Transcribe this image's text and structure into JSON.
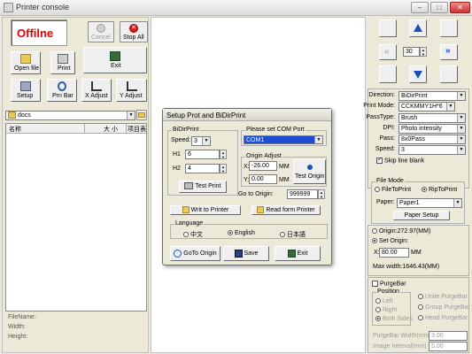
{
  "window": {
    "title": "Printer console"
  },
  "toolbar": {
    "status": "Offilne",
    "cancel": "Cancel",
    "stop_all": "Stop All",
    "open_file": "Open file",
    "print": "Print",
    "exit": "Exit",
    "setup": "Setup",
    "prn_bar": "Prn Bar",
    "x_adjust": "X Adjust",
    "y_adjust": "Y Adjust"
  },
  "files": {
    "folder": "docs",
    "columns": [
      "名称",
      "大 小",
      "项目表"
    ],
    "file_name_label": "FileName:",
    "width_label": "Width:",
    "height_label": "Height:"
  },
  "nav": {
    "value": "30"
  },
  "print_settings": {
    "direction": {
      "label": "Direction:",
      "value": "BiDirPrint"
    },
    "print_mode": {
      "label": "Print Mode:",
      "value": "CCKMMY1H*6"
    },
    "pass_type": {
      "label": "PassType:",
      "value": "Brush"
    },
    "dpi": {
      "label": "DPI:",
      "value": "Photo intensity"
    },
    "pass": {
      "label": "Pass:",
      "value": "8x0Pass"
    },
    "speed": {
      "label": "Speed:",
      "value": "3"
    },
    "skip_line_blank": "Skip line blank",
    "skip_checked": true
  },
  "file_mode": {
    "title": "File Mode",
    "file_to_print": "FileToPrint",
    "rip_to_print": "RipToPrint",
    "selected": "RipToPrint",
    "paper_label": "Paper:",
    "paper_value": "Paper1",
    "paper_setup": "Paper Setup"
  },
  "origin": {
    "origin_label": "Origin:272.97(MM)",
    "set_origin_label": "Set Origin:",
    "x_label": "X:",
    "x_value": "80.00",
    "x_unit": "MM",
    "max_width": "Max width:1646.43(MM)"
  },
  "purge": {
    "title": "PurgeBar",
    "position_title": "Position",
    "left": "Left",
    "right": "Right",
    "both_sides": "Both Sides",
    "unite": "Unite PurgeBar",
    "group": "Group PurgeBar",
    "head": "Head PurgeBar",
    "width_label": "PurgeBar Width(mm)",
    "width_value": "3.00",
    "interval_label": "Image Interval(mm)",
    "interval_value": "5.00"
  },
  "dialog": {
    "title": "Setup Prot and BiDirPrint",
    "bidir_title": "BiDirPrint",
    "speed_label": "Speed:",
    "speed_value": "3",
    "h1_label": "H1",
    "h1_value": "6",
    "h2_label": "H2",
    "h2_value": "4",
    "test_print": "Test Print",
    "com_title": "Please set COM Port",
    "com_value": "COM1",
    "origin_adjust_title": "Origin Adjust",
    "x_label": "X:",
    "x_value": "-26.00",
    "y_label": "Y:",
    "y_value": "0.00",
    "unit": "MM",
    "test_origin": "Test Origin",
    "goto_label": "Go to Origin:",
    "goto_value": "999999",
    "write_to_printer": "Writ to Printer",
    "read_from_printer": "Read form Printer",
    "language_title": "Language",
    "lang_cn": "中文",
    "lang_en": "English",
    "lang_other": "日本語",
    "lang_selected": "English",
    "goto_origin_btn": "GoTo Origin",
    "save": "Save",
    "exit": "Exit"
  },
  "colors": {
    "offline_red": "#e00000",
    "nav_blue": "#1a52b8",
    "selection_blue": "#1c4ed8"
  }
}
